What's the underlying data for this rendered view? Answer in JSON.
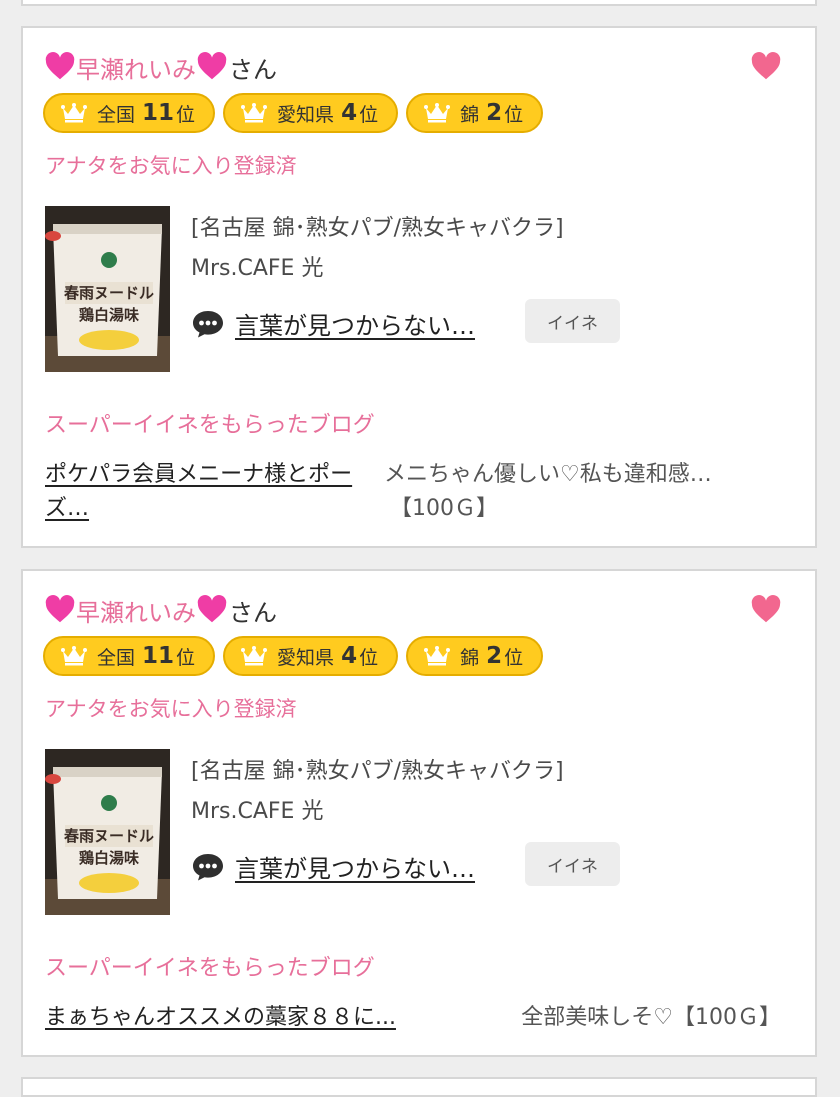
{
  "cards": [
    {
      "user_name": "早瀬れいみ",
      "san": "さん",
      "ranks": [
        {
          "label": "全国",
          "num": "11",
          "suffix": "位"
        },
        {
          "label": "愛知県",
          "num": "4",
          "suffix": "位"
        },
        {
          "label": "錦",
          "num": "2",
          "suffix": "位"
        }
      ],
      "favorite_status": "アナタをお気に入り登録済",
      "shop_area": "[名古屋 錦･熟女パブ/熟女キャバクラ]",
      "shop_name": "Mrs.CAFE 光",
      "comment": "言葉が見つからない…",
      "iine_label": "イイネ",
      "super_iine_title": "スーパーイイネをもらったブログ",
      "blog_title": "ポケパラ会員メニーナ様とポーズ…",
      "blog_desc_line1": "メニちゃん優しい♡私も違和感…",
      "blog_desc_line2": "【100Ｇ】"
    },
    {
      "user_name": "早瀬れいみ",
      "san": "さん",
      "ranks": [
        {
          "label": "全国",
          "num": "11",
          "suffix": "位"
        },
        {
          "label": "愛知県",
          "num": "4",
          "suffix": "位"
        },
        {
          "label": "錦",
          "num": "2",
          "suffix": "位"
        }
      ],
      "favorite_status": "アナタをお気に入り登録済",
      "shop_area": "[名古屋 錦･熟女パブ/熟女キャバクラ]",
      "shop_name": "Mrs.CAFE 光",
      "comment": "言葉が見つからない…",
      "iine_label": "イイネ",
      "super_iine_title": "スーパーイイネをもらったブログ",
      "blog_title": "まぁちゃんオススメの藁家８８に...",
      "blog_desc_line1": "全部美味しそ♡【100Ｇ】"
    }
  ],
  "thumb_label_1": "春雨ヌードル",
  "thumb_label_2": "鶏白湯味",
  "colors": {
    "accent_pink": "#e76f9a",
    "heart_pink": "#f2678f",
    "rank_yellow": "#ffcb1f"
  }
}
